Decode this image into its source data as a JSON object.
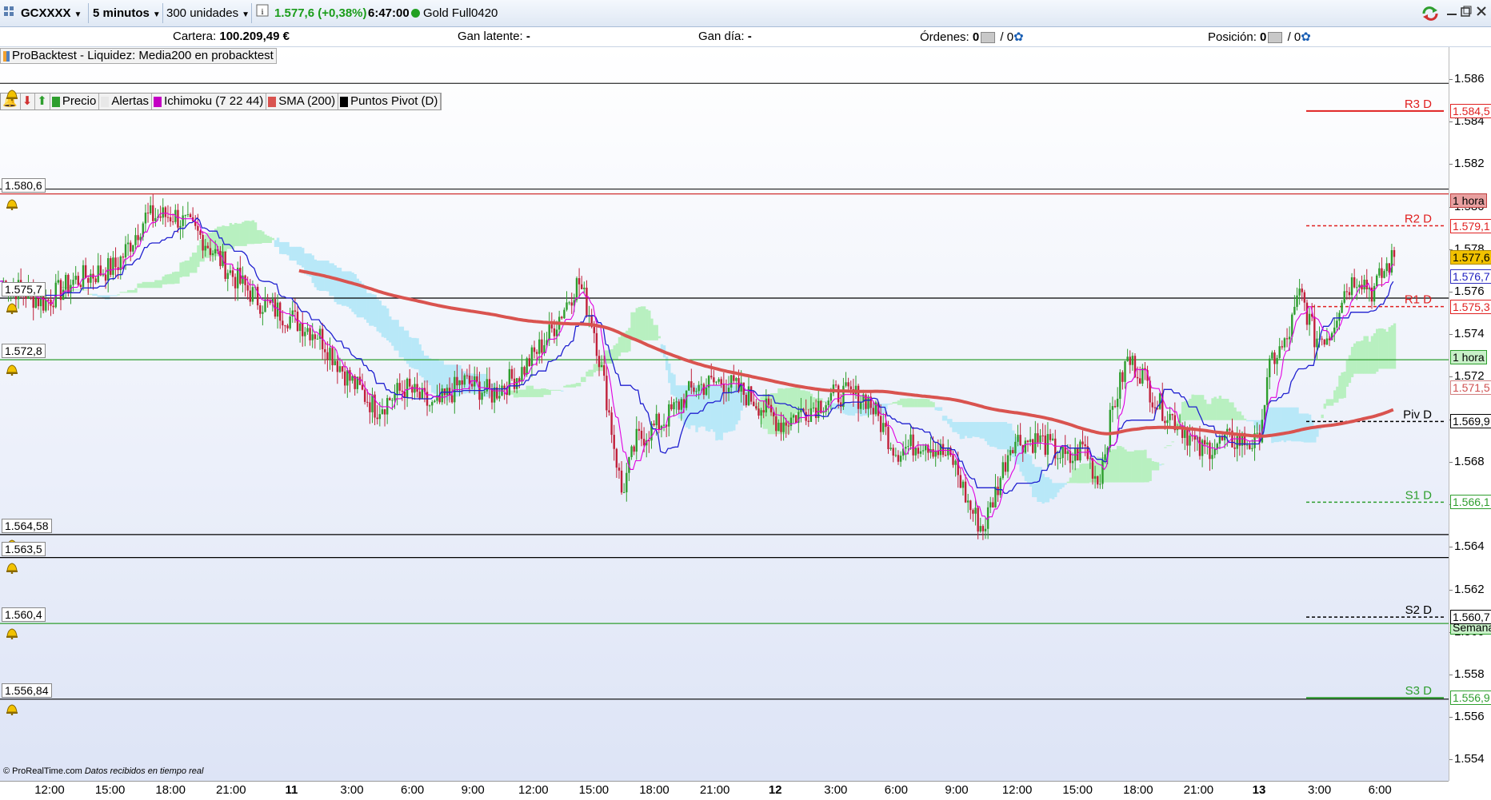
{
  "toolbar": {
    "instrument": "GCXXXX",
    "timeframe": "5 minutos",
    "units": "300 unidades",
    "quote": "1.577,6 (+0,38%)",
    "time": "6:47:00",
    "feed_name": "Gold Full0420",
    "quote_color": "#1a9c1a"
  },
  "account": {
    "cartera_label": "Cartera:",
    "cartera_value": "100.209,49 €",
    "gan_latente_label": "Gan latente:",
    "gan_latente_value": "-",
    "gan_dia_label": "Gan día:",
    "gan_dia_value": "-",
    "ordenes_label": "Órdenes:",
    "ordenes_value": "0",
    "ordenes_sep": "/ 0",
    "posicion_label": "Posición:",
    "posicion_value": "0",
    "posicion_sep": "/ 0"
  },
  "system_label": "ProBacktest - Liquidez: Media200 en probacktest",
  "indicators": [
    {
      "label": "Precio",
      "color": "#2e9e2e"
    },
    {
      "label": "Alertas",
      "color": "#e8e8e8"
    },
    {
      "label": "Ichimoku (7 22 44)",
      "color": "#c400c4"
    },
    {
      "label": "SMA (200)",
      "color": "#d9534f"
    },
    {
      "label": "Puntos Pivot (D)",
      "color": "#000000"
    }
  ],
  "price_axis": {
    "ticks": [
      "1.586",
      "1.584",
      "1.582",
      "1.580",
      "1.578",
      "1.576",
      "1.574",
      "1.572",
      "1.570",
      "1.568",
      "1.566",
      "1.564",
      "1.562",
      "1.560",
      "1.558",
      "1.556",
      "1.554"
    ],
    "ymin": 1.553,
    "ymax": 1.5875
  },
  "time_axis": {
    "labels": [
      "12:00",
      "15:00",
      "18:00",
      "21:00",
      "11",
      "3:00",
      "6:00",
      "9:00",
      "12:00",
      "15:00",
      "18:00",
      "21:00",
      "12",
      "3:00",
      "6:00",
      "9:00",
      "12:00",
      "15:00",
      "18:00",
      "21:00",
      "13",
      "3:00",
      "6:00"
    ],
    "bold": [
      "11",
      "12",
      "13"
    ]
  },
  "alert_levels": [
    {
      "label": "1.580,6",
      "value": 1.5806
    },
    {
      "label": "1.575,7",
      "value": 1.5757
    },
    {
      "label": "1.572,8",
      "value": 1.5728
    },
    {
      "label": "1.564,58",
      "value": 1.56458
    },
    {
      "label": "1.563,5",
      "value": 1.5635
    },
    {
      "label": "1.560,4",
      "value": 1.5604
    },
    {
      "label": "1.556,84",
      "value": 1.55684
    }
  ],
  "top_alert": {
    "value": 1.5858
  },
  "pivots": [
    {
      "name": "R3 D",
      "label": "1.584,5",
      "value": 1.5845,
      "color": "#e02020",
      "style": "solid"
    },
    {
      "name": "R2 D",
      "label": "1.579,1",
      "value": 1.5791,
      "color": "#e02020",
      "style": "dash"
    },
    {
      "name": "R1 D",
      "label": "1.575,3",
      "value": 1.5753,
      "color": "#e02020",
      "style": "dash"
    },
    {
      "name": "Piv D",
      "label": "1.569,9",
      "value": 1.5699,
      "color": "#000000",
      "style": "dash"
    },
    {
      "name": "S1 D",
      "label": "1.566,1",
      "value": 1.5661,
      "color": "#2e9e2e",
      "style": "dash"
    },
    {
      "name": "S2 D",
      "label": "1.560,7",
      "value": 1.5607,
      "color": "#000000",
      "style": "dash"
    },
    {
      "name": "S3 D",
      "label": "1.556,9",
      "value": 1.5569,
      "color": "#2e9e2e",
      "style": "solid"
    }
  ],
  "axis_badges": [
    {
      "label": "1 hora",
      "value": 1.5803,
      "bg": "#e8a0a0",
      "border": "#c04040"
    },
    {
      "label": "1.577,6",
      "value": 1.5776,
      "bg": "#f2c200",
      "border": "#b08a00"
    },
    {
      "label": "1.576,7",
      "value": 1.5767,
      "bg": "#ffffff",
      "border": "#3030c0",
      "fg": "#2020c0"
    },
    {
      "label": "1 hora",
      "value": 1.5729,
      "bg": "#c8f0c8",
      "border": "#2e9e2e"
    },
    {
      "label": "1.571,5",
      "value": 1.5715,
      "bg": "#ffffff",
      "border": "#d08080",
      "fg": "#d05050"
    },
    {
      "label": "Semanal",
      "value": 1.5602,
      "bg": "#c8f0c8",
      "border": "#2e9e2e"
    }
  ],
  "footer": {
    "copyright": "© ProRealTime.com",
    "note": "Datos recibidos en tiempo real"
  },
  "colors": {
    "bull": "#2e9e2e",
    "bear": "#c0203a",
    "sma": "#d9534f",
    "tenkan": "#e000e0",
    "kijun": "#2020d0",
    "cloud_up": "#b8f0c0",
    "cloud_down": "#b8e8f8",
    "bg_top": "#ffffff",
    "bg_bottom": "#dde4f6"
  },
  "chart_data": {
    "type": "candlestick",
    "title": "",
    "xlabel": "",
    "ylabel": "",
    "ylim": [
      1.553,
      1.5875
    ],
    "close_path": [
      [
        0,
        1.5765
      ],
      [
        0.03,
        1.5755
      ],
      [
        0.05,
        1.5765
      ],
      [
        0.08,
        1.5772
      ],
      [
        0.1,
        1.5795
      ],
      [
        0.12,
        1.5796
      ],
      [
        0.14,
        1.5785
      ],
      [
        0.16,
        1.5768
      ],
      [
        0.18,
        1.5755
      ],
      [
        0.2,
        1.5748
      ],
      [
        0.22,
        1.574
      ],
      [
        0.24,
        1.572
      ],
      [
        0.26,
        1.5705
      ],
      [
        0.28,
        1.5715
      ],
      [
        0.3,
        1.5705
      ],
      [
        0.32,
        1.5718
      ],
      [
        0.34,
        1.5712
      ],
      [
        0.36,
        1.5722
      ],
      [
        0.38,
        1.574
      ],
      [
        0.4,
        1.5765
      ],
      [
        0.41,
        1.5745
      ],
      [
        0.42,
        1.5708
      ],
      [
        0.43,
        1.5665
      ],
      [
        0.44,
        1.569
      ],
      [
        0.46,
        1.57
      ],
      [
        0.48,
        1.5715
      ],
      [
        0.5,
        1.5718
      ],
      [
        0.52,
        1.571
      ],
      [
        0.54,
        1.5698
      ],
      [
        0.56,
        1.5705
      ],
      [
        0.58,
        1.5712
      ],
      [
        0.6,
        1.571
      ],
      [
        0.62,
        1.5685
      ],
      [
        0.64,
        1.569
      ],
      [
        0.66,
        1.568
      ],
      [
        0.67,
        1.566
      ],
      [
        0.68,
        1.5648
      ],
      [
        0.69,
        1.5668
      ],
      [
        0.7,
        1.569
      ],
      [
        0.72,
        1.569
      ],
      [
        0.74,
        1.568
      ],
      [
        0.75,
        1.5688
      ],
      [
        0.76,
        1.567
      ],
      [
        0.77,
        1.5705
      ],
      [
        0.78,
        1.5728
      ],
      [
        0.79,
        1.5722
      ],
      [
        0.8,
        1.5708
      ],
      [
        0.82,
        1.5695
      ],
      [
        0.83,
        1.5685
      ],
      [
        0.84,
        1.5688
      ],
      [
        0.85,
        1.569
      ],
      [
        0.86,
        1.569
      ],
      [
        0.87,
        1.5688
      ],
      [
        0.88,
        1.5728
      ],
      [
        0.89,
        1.5735
      ],
      [
        0.9,
        1.576
      ],
      [
        0.91,
        1.5738
      ],
      [
        0.92,
        1.574
      ],
      [
        0.93,
        1.576
      ],
      [
        0.94,
        1.5768
      ],
      [
        0.95,
        1.576
      ],
      [
        0.96,
        1.5772
      ],
      [
        0.965,
        1.5776
      ]
    ]
  }
}
